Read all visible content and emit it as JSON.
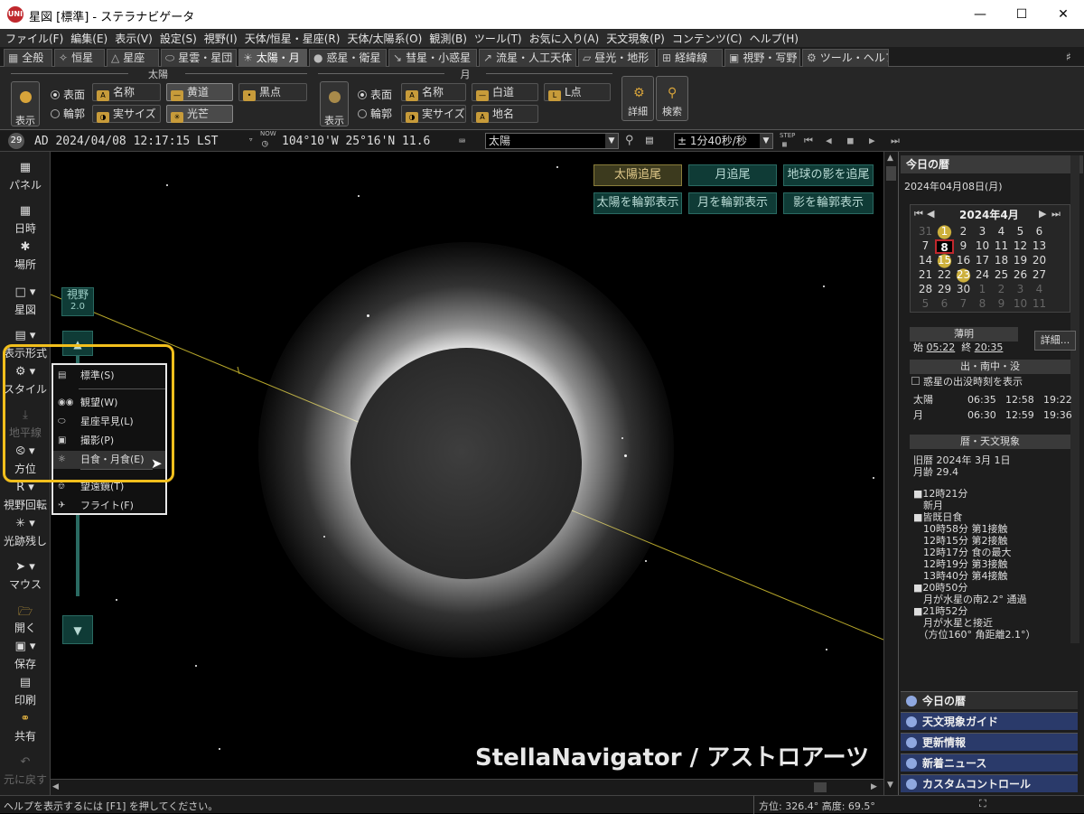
{
  "window": {
    "title": "星図 [標準] - ステラナビゲータ",
    "app_icon": "UNI"
  },
  "menu": [
    "ファイル(F)",
    "編集(E)",
    "表示(V)",
    "設定(S)",
    "視野(I)",
    "天体/恒星・星座(R)",
    "天体/太陽系(O)",
    "観測(B)",
    "ツール(T)",
    "お気に入り(A)",
    "天文現象(P)",
    "コンテンツ(C)",
    "ヘルプ(H)"
  ],
  "tabs": [
    "全般",
    "恒星",
    "星座",
    "星雲・星団",
    "太陽・月",
    "惑星・衛星",
    "彗星・小惑星",
    "流星・人工天体",
    "昼光・地形",
    "経緯線",
    "視野・写野",
    "ツール・ヘルプ"
  ],
  "ribbon": {
    "sun_group": "太陽",
    "moon_group": "月",
    "show": "表示",
    "surface": "表面",
    "outline": "輪郭",
    "sun_name": "名称",
    "ecliptic": "黄道",
    "sunspot": "黒点",
    "real_size": "実サイズ",
    "glare": "光芒",
    "moon_name": "名称",
    "white_path": "白道",
    "lpoint": "L点",
    "moon_real_size": "実サイズ",
    "place_names": "地名",
    "details": "詳細",
    "search": "検索"
  },
  "status": {
    "day_badge": "29",
    "datetime": "AD 2024/04/08 12:17:15 LST",
    "now": "NOW",
    "location": "104°10'W 25°16'N 11.6",
    "target": "太陽",
    "step": "± 1分40秒/秒",
    "step_label": "STEP"
  },
  "left_toolbar": [
    "パネル",
    "日時",
    "場所",
    "星図",
    "表示形式",
    "スタイル",
    "地平線",
    "方位",
    "視野回転",
    "光跡残し",
    "マウス",
    "開く",
    "保存",
    "印刷",
    "共有",
    "元に戻す"
  ],
  "sky": {
    "fov_label": "視野",
    "fov_value": "2.0",
    "track_buttons": [
      "太陽追尾",
      "月追尾",
      "地球の影を追尾"
    ],
    "outline_buttons": [
      "太陽を輪郭表示",
      "月を輪郭表示",
      "影を輪郭表示"
    ],
    "watermark": "StellaNavigator / アストロアーツ"
  },
  "style_menu": {
    "items": [
      {
        "label": "標準(S)",
        "icon": "chart-icon"
      },
      {
        "label": "観望(W)",
        "icon": "binoculars-icon"
      },
      {
        "label": "星座早見(L)",
        "icon": "planisphere-icon"
      },
      {
        "label": "撮影(P)",
        "icon": "camera-icon"
      },
      {
        "label": "日食・月食(E)",
        "icon": "eclipse-icon"
      },
      {
        "label": "望遠鏡(T)",
        "icon": "telescope-icon"
      },
      {
        "label": "フライト(F)",
        "icon": "flight-icon"
      }
    ],
    "selected": "日食・月食(E)"
  },
  "right_panel": {
    "header": "今日の暦",
    "date": "2024年04月08日(月)",
    "calendar": {
      "month": "2024年4月",
      "days": [
        "31",
        "1",
        "2",
        "3",
        "4",
        "5",
        "6",
        "7",
        "8",
        "9",
        "10",
        "11",
        "12",
        "13",
        "14",
        "15",
        "16",
        "17",
        "18",
        "19",
        "20",
        "21",
        "22",
        "23",
        "24",
        "25",
        "26",
        "27",
        "28",
        "29",
        "30",
        "1",
        "2",
        "3",
        "4",
        "5",
        "6",
        "7",
        "8",
        "9",
        "10",
        "11"
      ]
    },
    "twilight_label": "薄明",
    "twilight_start": "05:22",
    "twilight_end": "20:35",
    "twilight_start_prefix": "始",
    "twilight_end_prefix": "終",
    "details_button": "詳細...",
    "rise_label": "出・南中・没",
    "planet_checkbox": "惑星の出没時刻を表示",
    "sun_row": [
      "太陽",
      "06:35",
      "12:58",
      "19:22"
    ],
    "moon_row": [
      "月",
      "06:30",
      "12:59",
      "19:36"
    ],
    "calendar_section": "暦・天文現象",
    "lunar_date": "旧暦 2024年 3月 1日",
    "moon_age": "月齢 29.4",
    "events": [
      "■12時21分",
      "　新月",
      "■皆既日食",
      "　10時58分 第1接触",
      "　12時15分 第2接触",
      "　12時17分 食の最大",
      "　12時19分 第3接触",
      "　13時40分 第4接触",
      "■20時50分",
      "　月が水星の南2.2° 通過",
      "■21時52分",
      "　月が水星と接近",
      "　（方位160° 角距離2.1°）"
    ],
    "bottom_tabs": [
      "今日の暦",
      "天文現象ガイド",
      "更新情報",
      "新着ニュース",
      "カスタムコントロール"
    ]
  },
  "statusbar": {
    "help": "ヘルプを表示するには [F1] を押してください。",
    "direction": "方位: 326.4° 高度: 69.5°"
  }
}
